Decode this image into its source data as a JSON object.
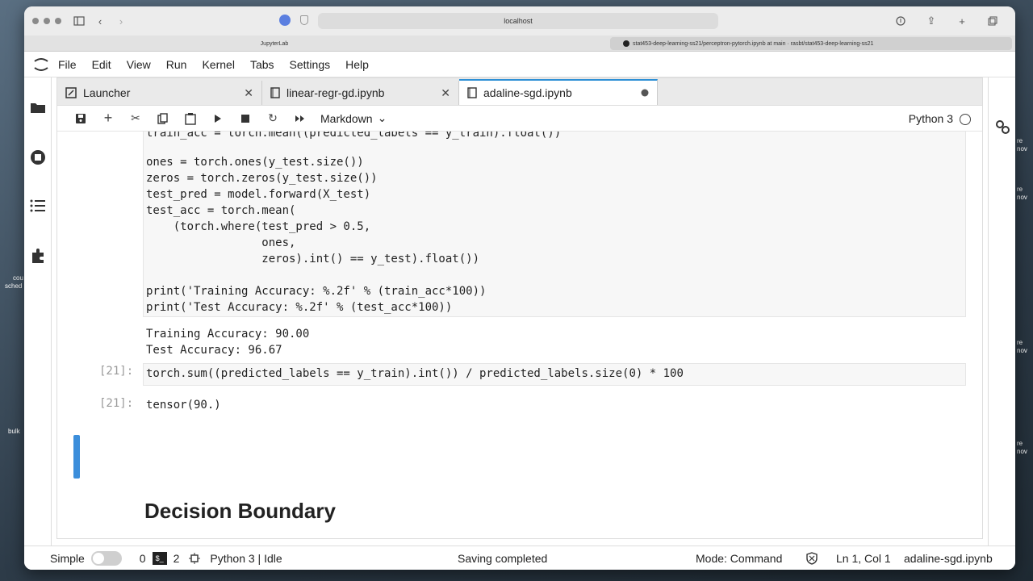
{
  "browser": {
    "url": "localhost",
    "tabs": [
      {
        "title": "JupyterLab"
      },
      {
        "title": "stat453-deep-learning-ss21/perceptron-pytorch.ipynb at main · rasbt/stat453-deep-learning-ss21"
      }
    ]
  },
  "menubar": {
    "items": [
      "File",
      "Edit",
      "View",
      "Run",
      "Kernel",
      "Tabs",
      "Settings",
      "Help"
    ]
  },
  "doc_tabs": [
    {
      "label": "Launcher",
      "icon": "launcher-icon"
    },
    {
      "label": "linear-regr-gd.ipynb",
      "icon": "notebook-icon"
    },
    {
      "label": "adaline-sgd.ipynb",
      "icon": "notebook-icon"
    }
  ],
  "notebook_toolbar": {
    "cell_type": "Markdown",
    "kernel": "Python 3"
  },
  "cells": {
    "code_top_partial": "train_acc = torch.mean((predicted_labels == y_train).float())",
    "code_lines": [
      "ones = torch.ones(y_test.size())",
      "zeros = torch.zeros(y_test.size())",
      "test_pred = model.forward(X_test)",
      "test_acc = torch.mean(",
      "    (torch.where(test_pred > 0.5,",
      "                 ones,",
      "                 zeros).int() == y_test).float())",
      "",
      "print('Training Accuracy: %.2f' % (train_acc*100))",
      "print('Test Accuracy: %.2f' % (test_acc*100))"
    ],
    "output_lines": [
      "Training Accuracy: 90.00",
      "Test Accuracy: 96.67"
    ],
    "cell21_prompt_in": "[21]:",
    "cell21_code": "torch.sum((predicted_labels == y_train).int()) / predicted_labels.size(0) * 100",
    "cell21_prompt_out": "[21]:",
    "cell21_output": "tensor(90.)",
    "markdown_heading": "Decision Boundary"
  },
  "statusbar": {
    "mode_label": "Simple",
    "terminals_count": "0",
    "kernels_count": "2",
    "kernel_status": "Python 3 | Idle",
    "save_status": "Saving completed",
    "mode": "Mode: Command",
    "position": "Ln 1, Col 1",
    "filename": "adaline-sgd.ipynb"
  },
  "desktop_labels": [
    "cou",
    "sched",
    "bulk",
    "re",
    "nov",
    "re",
    "nov",
    "re",
    "nov",
    "re",
    "nov"
  ]
}
